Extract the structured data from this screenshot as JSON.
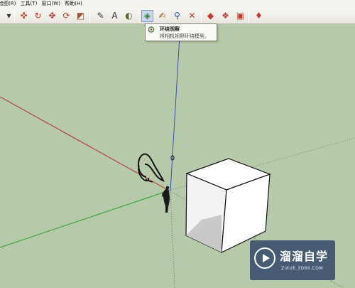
{
  "menubar": {
    "items": [
      "绘图(R)",
      "工具(T)",
      "窗口(W)",
      "帮助(H)"
    ]
  },
  "toolbar": {
    "buttons": [
      {
        "name": "dropdown-arrow-icon",
        "glyph": "▾",
        "color": "#333333"
      },
      {
        "name": "orbit-tool-icon",
        "glyph": "✜",
        "color": "#c0392b"
      },
      {
        "name": "rotate-tool-icon",
        "glyph": "↻",
        "color": "#c0392b"
      },
      {
        "name": "move-tool-icon",
        "glyph": "✥",
        "color": "#c0392b"
      },
      {
        "name": "refresh-icon",
        "glyph": "⟳",
        "color": "#c0392b"
      },
      {
        "name": "scale-tool-icon",
        "glyph": "◩",
        "color": "#a0522d"
      },
      {
        "name": "tape-measure-icon",
        "glyph": "✎",
        "color": "#333333"
      },
      {
        "name": "dimension-icon",
        "glyph": "A",
        "color": "#333333"
      },
      {
        "name": "protractor-icon",
        "glyph": "◐",
        "color": "#556b2f"
      },
      {
        "name": "look-around-icon",
        "glyph": "◈",
        "color": "#2e7d32"
      },
      {
        "name": "walk-icon",
        "glyph": "✍",
        "color": "#8b6914"
      },
      {
        "name": "zoom-icon",
        "glyph": "⚲",
        "color": "#1f4aa8"
      },
      {
        "name": "zoom-extents-icon",
        "glyph": "✕",
        "color": "#c0392b"
      },
      {
        "name": "section-plane-icon",
        "glyph": "◆",
        "color": "#c0392b"
      },
      {
        "name": "component-icon",
        "glyph": "❖",
        "color": "#c0392b"
      },
      {
        "name": "warehouse-icon",
        "glyph": "▣",
        "color": "#c0392b"
      },
      {
        "name": "ruby-icon",
        "glyph": "♦",
        "color": "#c0392b"
      }
    ]
  },
  "tooltip": {
    "title": "环绕观察",
    "description": "将相机视野环绕模型。"
  },
  "watermark": {
    "title": "溜溜自学",
    "subtitle": "ZIXUE.3D66.COM"
  },
  "colors": {
    "viewport_background": "#b6c9a8",
    "axis_red": "#b03030",
    "axis_green": "#2ea12e",
    "axis_blue": "#3a4fb0"
  }
}
